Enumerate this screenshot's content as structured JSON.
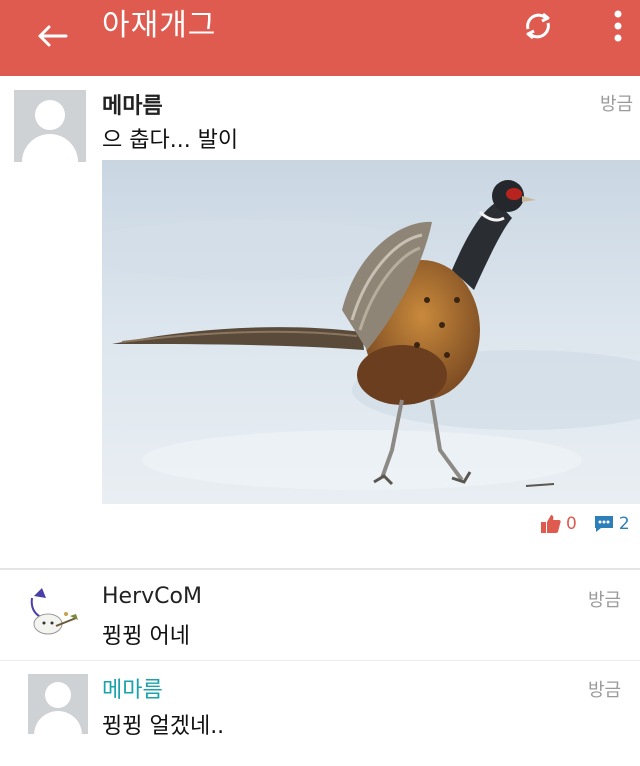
{
  "appbar": {
    "title": "아재개그",
    "back_icon": "arrow-left-icon",
    "refresh_icon": "refresh-icon",
    "more_icon": "more-vertical-icon",
    "color": "#e05b4f"
  },
  "post": {
    "author": "메마름",
    "time": "방금",
    "text": "으 춥다... 발이",
    "image_alt": "pheasant walking on snow",
    "likes": "0",
    "comments": "2"
  },
  "comments": [
    {
      "author": "HervCoM",
      "text": "뀡뀡 어네",
      "time": "방금",
      "author_color": "#222222"
    },
    {
      "author": "메마름",
      "text": "뀡뀡 얼겠네..",
      "time": "방금",
      "author_color": "#1aa3a9"
    }
  ]
}
